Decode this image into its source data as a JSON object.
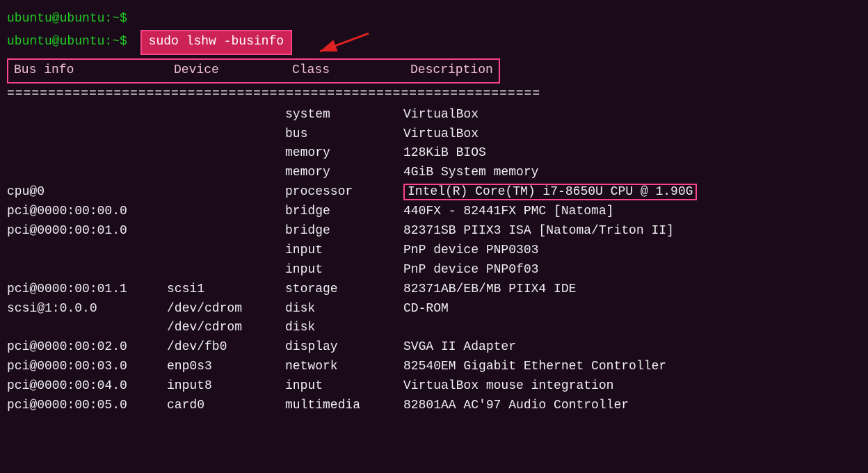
{
  "terminal": {
    "line1": "ubuntu@ubuntu:~$",
    "prompt2": "ubuntu@ubuntu:~$",
    "command": "sudo lshw -businfo",
    "separator": "=================================================================",
    "header": {
      "businfo": "Bus info",
      "device": "Device",
      "class": "Class",
      "description": "Description"
    },
    "rows": [
      {
        "businfo": "",
        "device": "",
        "class": "system",
        "desc": "VirtualBox",
        "highlight": false
      },
      {
        "businfo": "",
        "device": "",
        "class": "bus",
        "desc": "VirtualBox",
        "highlight": false
      },
      {
        "businfo": "",
        "device": "",
        "class": "memory",
        "desc": "128KiB BIOS",
        "highlight": false
      },
      {
        "businfo": "",
        "device": "",
        "class": "memory",
        "desc": "4GiB System memory",
        "highlight": false
      },
      {
        "businfo": "cpu@0",
        "device": "",
        "class": "processor",
        "desc": "Intel(R) Core(TM) i7-8650U CPU @ 1.90G",
        "highlight": true
      },
      {
        "businfo": "pci@0000:00:00.0",
        "device": "",
        "class": "bridge",
        "desc": "440FX - 82441FX PMC [Natoma]",
        "highlight": false
      },
      {
        "businfo": "pci@0000:00:01.0",
        "device": "",
        "class": "bridge",
        "desc": "82371SB PIIX3 ISA [Natoma/Triton II]",
        "highlight": false
      },
      {
        "businfo": "",
        "device": "",
        "class": "input",
        "desc": "PnP device PNP0303",
        "highlight": false
      },
      {
        "businfo": "",
        "device": "",
        "class": "input",
        "desc": "PnP device PNP0f03",
        "highlight": false
      },
      {
        "businfo": "pci@0000:00:01.1",
        "device": "scsi1",
        "class": "storage",
        "desc": "82371AB/EB/MB PIIX4 IDE",
        "highlight": false
      },
      {
        "businfo": "scsi@1:0.0.0",
        "device": "/dev/cdrom",
        "class": "disk",
        "desc": "CD-ROM",
        "highlight": false
      },
      {
        "businfo": "",
        "device": "/dev/cdrom",
        "class": "disk",
        "desc": "",
        "highlight": false
      },
      {
        "businfo": "pci@0000:00:02.0",
        "device": "/dev/fb0",
        "class": "display",
        "desc": "SVGA II Adapter",
        "highlight": false
      },
      {
        "businfo": "pci@0000:00:03.0",
        "device": "enp0s3",
        "class": "network",
        "desc": "82540EM Gigabit Ethernet Controller",
        "highlight": false
      },
      {
        "businfo": "pci@0000:00:04.0",
        "device": "input8",
        "class": "input",
        "desc": "VirtualBox mouse integration",
        "highlight": false
      },
      {
        "businfo": "pci@0000:00:05.0",
        "device": "card0",
        "class": "multimedia",
        "desc": "82801AA AC'97 Audio Controller",
        "highlight": false
      }
    ]
  }
}
